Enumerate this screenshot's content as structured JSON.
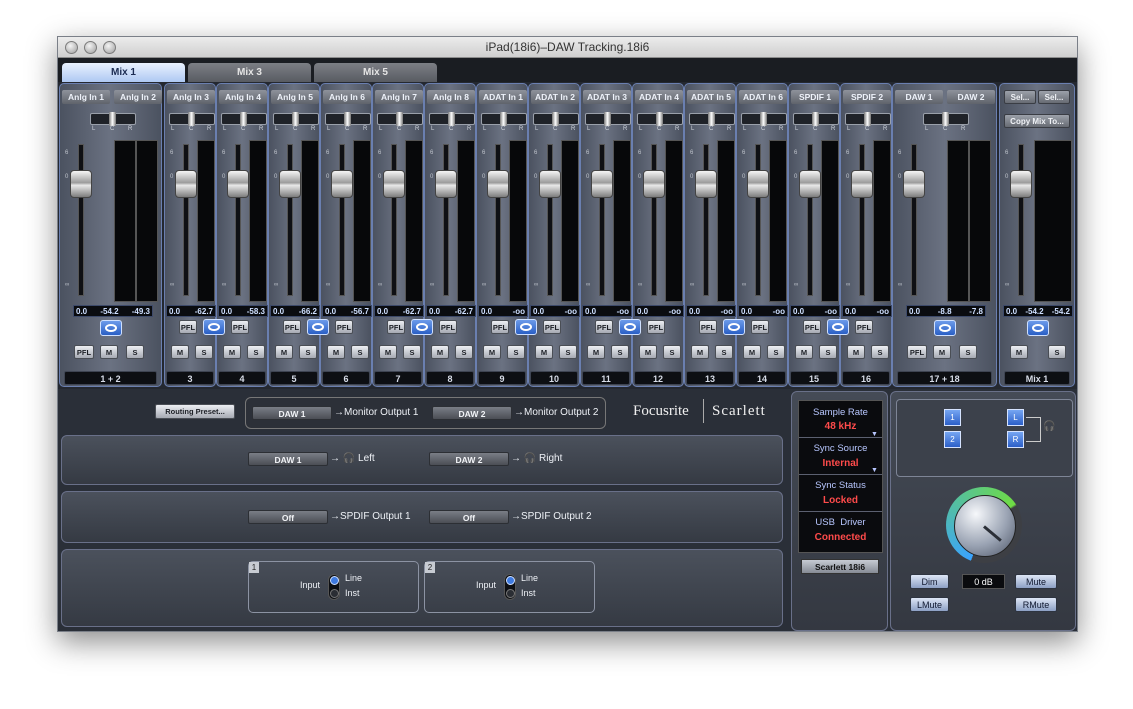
{
  "window": {
    "title": "iPad(18i6)–DAW Tracking.18i6"
  },
  "tabs": [
    {
      "label": "Mix 1",
      "active": true
    },
    {
      "label": "Mix 3",
      "active": false
    },
    {
      "label": "Mix 5",
      "active": false
    }
  ],
  "pan_labels": [
    "L",
    "C",
    "R"
  ],
  "scale_marks": [
    "6",
    "0",
    "∞"
  ],
  "channels": [
    {
      "name": "Anlg In 1",
      "values": [
        "0.0",
        "-54.2",
        "-49.3"
      ]
    },
    {
      "name": "Anlg In 2"
    },
    {
      "name": "Anlg In 3",
      "values": [
        "0.0",
        "-62.7"
      ]
    },
    {
      "name": "Anlg In 4",
      "values": [
        "0.0",
        "-58.3"
      ]
    },
    {
      "name": "Anlg In 5",
      "values": [
        "0.0",
        "-66.2"
      ]
    },
    {
      "name": "Anlg In 6",
      "values": [
        "0.0",
        "-56.7"
      ]
    },
    {
      "name": "Anlg In 7",
      "values": [
        "0.0",
        "-62.7"
      ]
    },
    {
      "name": "Anlg In 8",
      "values": [
        "0.0",
        "-62.7"
      ]
    },
    {
      "name": "ADAT In 1",
      "values": [
        "0.0",
        "-oo"
      ]
    },
    {
      "name": "ADAT In 2",
      "values": [
        "0.0",
        "-oo"
      ]
    },
    {
      "name": "ADAT In 3",
      "values": [
        "0.0",
        "-oo"
      ]
    },
    {
      "name": "ADAT In 4",
      "values": [
        "0.0",
        "-oo"
      ]
    },
    {
      "name": "ADAT In 5",
      "values": [
        "0.0",
        "-oo"
      ]
    },
    {
      "name": "ADAT In 6",
      "values": [
        "0.0",
        "-oo"
      ]
    },
    {
      "name": "SPDIF 1",
      "values": [
        "0.0",
        "-oo"
      ]
    },
    {
      "name": "SPDIF 2",
      "values": [
        "0.0",
        "-oo"
      ]
    },
    {
      "name": "DAW 1",
      "values": [
        "0.0",
        "-8.8",
        "-7.8"
      ]
    },
    {
      "name": "DAW 2"
    }
  ],
  "outputs": [
    "1 + 2",
    "3",
    "4",
    "5",
    "6",
    "7",
    "8",
    "9",
    "10",
    "11",
    "12",
    "13",
    "14",
    "15",
    "16",
    "17 + 18"
  ],
  "master": {
    "sel1": "Sel...",
    "sel2": "Sel...",
    "copy": "Copy Mix To...",
    "values": [
      "0.0",
      "-54.2",
      "-54.2"
    ],
    "out": "Mix 1"
  },
  "buttons": {
    "pfl": "PFL",
    "m": "M",
    "s": "S"
  },
  "routing": {
    "preset": "Routing Preset...",
    "brand": "Focusrite",
    "brand2": "Scarlett",
    "row1": [
      {
        "src": "DAW 1",
        "dest": "Monitor Output 1"
      },
      {
        "src": "DAW 2",
        "dest": "Monitor Output 2"
      }
    ],
    "row2": [
      {
        "src": "DAW 1",
        "dest": "Left"
      },
      {
        "src": "DAW 2",
        "dest": "Right"
      }
    ],
    "row3": [
      {
        "src": "Off",
        "dest": "SPDIF Output 1"
      },
      {
        "src": "Off",
        "dest": "SPDIF Output 2"
      }
    ],
    "inputs": [
      {
        "num": "1",
        "label": "Input",
        "opt1": "Line",
        "opt2": "Inst"
      },
      {
        "num": "2",
        "label": "Input",
        "opt1": "Line",
        "opt2": "Inst"
      }
    ]
  },
  "status": {
    "sample_rate_label": "Sample Rate",
    "sample_rate": "48 kHz",
    "sync_source_label": "Sync Source",
    "sync_source": "Internal",
    "sync_status_label": "Sync Status",
    "sync_status": "Locked",
    "usb_label": "USB  Driver",
    "usb": "Connected",
    "device": "Scarlett 18i6"
  },
  "monitor": {
    "btn1": "1",
    "btn2": "2",
    "btnL": "L",
    "btnR": "R",
    "dim": "Dim",
    "mute": "Mute",
    "level": "0 dB",
    "lmute": "LMute",
    "rmute": "RMute"
  },
  "colors": {
    "accent": "#3e7ae0",
    "status_value": "#ff4b4b",
    "status_label": "#b8c7ff"
  }
}
